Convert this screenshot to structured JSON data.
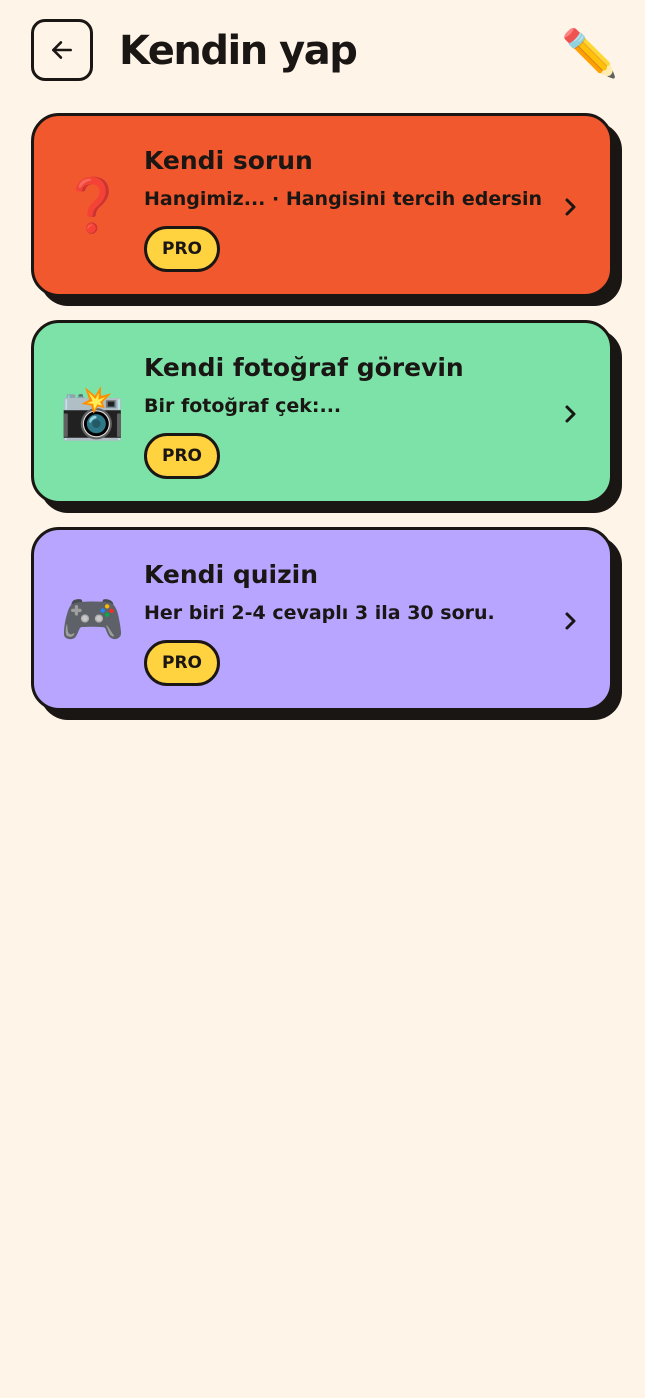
{
  "header": {
    "title": "Kendin yap",
    "back_icon": "arrow-left-icon",
    "edit_icon": "pencil-icon",
    "edit_glyph": "✏️"
  },
  "cards": [
    {
      "title": "Kendi sorun",
      "subtitle": "Hangimiz... · Hangisini tercih edersin...",
      "badge": "PRO",
      "icon": "question-mark-icon",
      "glyph": "❓",
      "color": "#F2582E"
    },
    {
      "title": "Kendi fotoğraf görevin",
      "subtitle": "Bir fotoğraf çek:...",
      "badge": "PRO",
      "icon": "camera-flash-icon",
      "glyph": "📸",
      "color": "#7DE2A8"
    },
    {
      "title": "Kendi quizin",
      "subtitle": "Her biri 2-4 cevaplı 3 ila 30 soru.",
      "badge": "PRO",
      "icon": "game-controller-icon",
      "glyph": "🎮",
      "color": "#B7A5FF"
    }
  ],
  "colors": {
    "background": "#FEF4E8",
    "ink": "#1A1614",
    "badge": "#FFD23F"
  }
}
